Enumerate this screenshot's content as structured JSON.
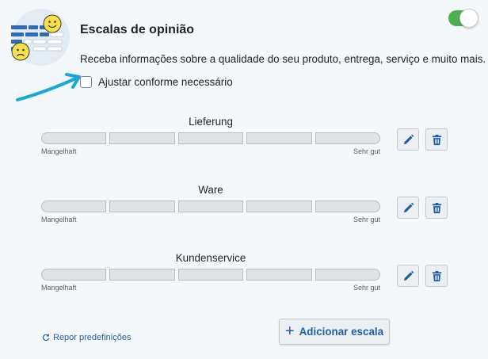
{
  "header": {
    "title": "Escalas de opinião",
    "toggle_on": true,
    "description": "Receba informações sobre a qualidade do seu produto, entrega, serviço e muito mais."
  },
  "option": {
    "label": "Ajustar conforme necessário",
    "checked": false
  },
  "scales": [
    {
      "title": "Lieferung",
      "low_label": "Mangelhaft",
      "high_label": "Sehr gut",
      "segments": 5
    },
    {
      "title": "Ware",
      "low_label": "Mangelhaft",
      "high_label": "Sehr gut",
      "segments": 5
    },
    {
      "title": "Kundenservice",
      "low_label": "Mangelhaft",
      "high_label": "Sehr gut",
      "segments": 5
    }
  ],
  "footer": {
    "reset_label": "Repor predefinições",
    "add_label": "Adicionar escala"
  },
  "icons": {
    "edit": "pencil-icon",
    "delete": "trash-icon",
    "reset": "refresh-icon",
    "add": "plus-icon"
  },
  "colors": {
    "accent": "#1e5fa8",
    "toggle": "#4caf50",
    "smiley": "#f7e04a"
  }
}
